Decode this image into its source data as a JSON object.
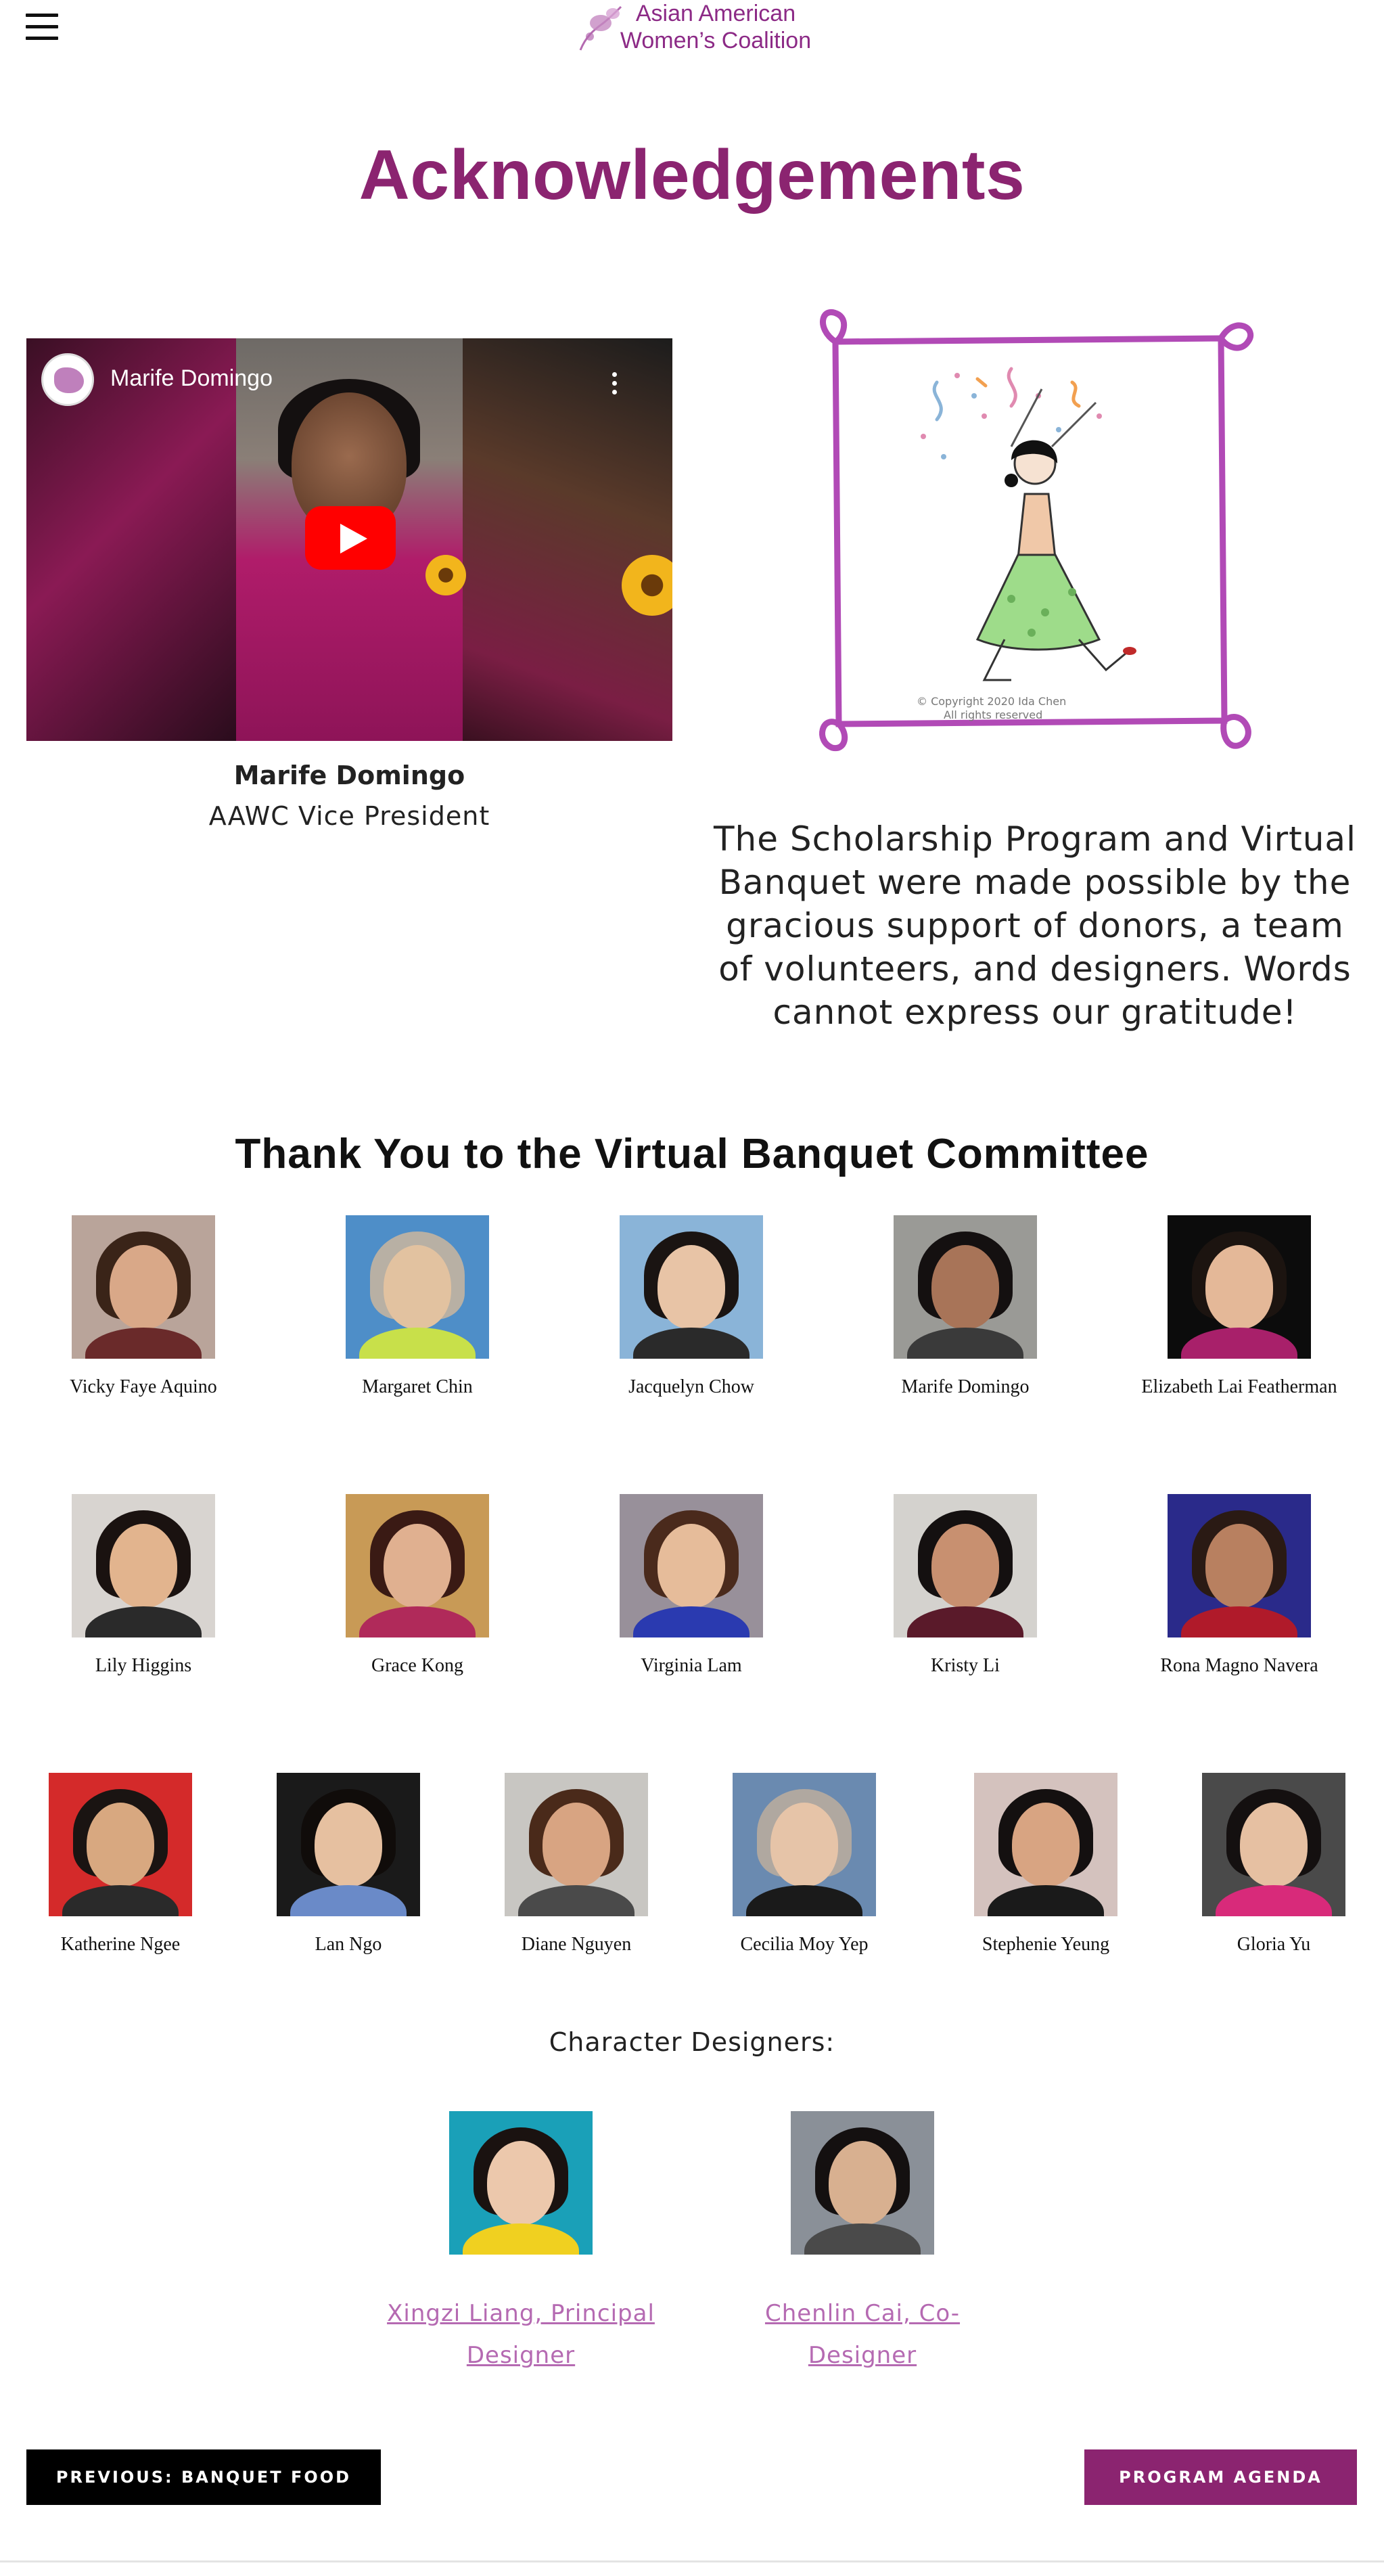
{
  "header": {
    "logo_line1": "Asian American",
    "logo_line2": "Women’s Coalition",
    "menu_icon": "hamburger-menu-icon"
  },
  "page_title": "Acknowledgements",
  "video": {
    "title": "Marife Domingo",
    "play_icon": "youtube-play-icon",
    "menu_icon": "kebab-menu-icon"
  },
  "featured": {
    "name": "Marife Domingo",
    "role": "AAWC Vice President"
  },
  "illustration": {
    "copyright_line1": "© Copyright 2020 Ida Chen",
    "copyright_line2": "All rights reserved"
  },
  "gratitude_text": "The Scholarship Program and Virtual Banquet were made possible by the gracious support of donors, a team of volunteers, and designers.  Words cannot express our gratitude!",
  "committee": {
    "title": "Thank You to the Virtual Banquet Committee",
    "members": [
      {
        "name": "Vicky Faye Aquino",
        "bg": "#b9a49a",
        "hair": "#3a2418",
        "skin": "#d9a888",
        "top": "#6a2a2a"
      },
      {
        "name": "Margaret Chin",
        "bg": "#4e8ec8",
        "hair": "#b8b0a4",
        "skin": "#e2c2a0",
        "top": "#c8e04a"
      },
      {
        "name": "Jacquelyn Chow",
        "bg": "#8ab4d8",
        "hair": "#1a1412",
        "skin": "#e8c4a6",
        "top": "#2a2a2a"
      },
      {
        "name": "Marife Domingo",
        "bg": "#9a9a96",
        "hair": "#141010",
        "skin": "#a87458",
        "top": "#3a3a3a"
      },
      {
        "name": "Elizabeth Lai Featherman",
        "bg": "#0c0c0c",
        "hair": "#1c1410",
        "skin": "#e4b898",
        "top": "#a8206a"
      },
      {
        "name": "Lily Higgins",
        "bg": "#d8d4d0",
        "hair": "#1a1210",
        "skin": "#e2b48e",
        "top": "#2a2a2a"
      },
      {
        "name": "Grace Kong",
        "bg": "#c89a56",
        "hair": "#3a1a14",
        "skin": "#e0b090",
        "top": "#b02a5a"
      },
      {
        "name": "Virginia Lam",
        "bg": "#98909a",
        "hair": "#4a2a1c",
        "skin": "#e6bc9a",
        "top": "#2a3ab0"
      },
      {
        "name": "Kristy Li",
        "bg": "#d4d2ce",
        "hair": "#141010",
        "skin": "#c89070",
        "top": "#5a1a2a"
      },
      {
        "name": "Rona Magno Navera",
        "bg": "#2a2a8a",
        "hair": "#2a1a14",
        "skin": "#b88060",
        "top": "#b01a2a"
      },
      {
        "name": "Katherine Ngee",
        "bg": "#d42a2a",
        "hair": "#1a1412",
        "skin": "#d8a880",
        "top": "#2a2a2a"
      },
      {
        "name": "Lan Ngo",
        "bg": "#1a1a1a",
        "hair": "#100c0a",
        "skin": "#e6c0a0",
        "top": "#6a8ac8"
      },
      {
        "name": "Diane Nguyen",
        "bg": "#c8c6c2",
        "hair": "#4a2a1a",
        "skin": "#d8a482",
        "top": "#4a4a4a"
      },
      {
        "name": "Cecilia Moy Yep",
        "bg": "#6a8ab0",
        "hair": "#b0a8a0",
        "skin": "#e6c4a8",
        "top": "#1a1a1a"
      },
      {
        "name": "Stephenie Yeung",
        "bg": "#d4c2be",
        "hair": "#141010",
        "skin": "#d8a482",
        "top": "#1a1a1a"
      },
      {
        "name": "Gloria Yu",
        "bg": "#4a4a4a",
        "hair": "#141010",
        "skin": "#e6c0a2",
        "top": "#d82a7a"
      }
    ]
  },
  "designers": {
    "title": "Character Designers:",
    "items": [
      {
        "label_line1": "Xingzi Liang, Principal",
        "label_line2": "Designer",
        "bg": "#1aa0b8",
        "hair": "#1a1210",
        "skin": "#ecc8ac",
        "top": "#f0d020"
      },
      {
        "label_line1": "Chenlin Cai, Co-Designer",
        "label_line2": "",
        "bg": "#8a9098",
        "hair": "#141010",
        "skin": "#d8b090",
        "top": "#4a4a4a"
      }
    ]
  },
  "nav": {
    "prev_label": "PREVIOUS: BANQUET FOOD",
    "next_label": "PROGRAM AGENDA"
  },
  "colors": {
    "brand": "#8b2470",
    "link": "#b56ab2",
    "frame": "#b14ab6"
  }
}
